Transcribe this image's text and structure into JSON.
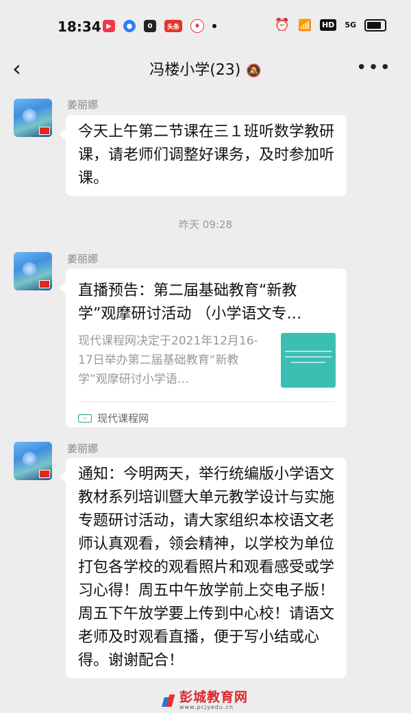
{
  "status_bar": {
    "time": "18:34",
    "apps": [
      "video-app-icon",
      "browser-app-icon",
      "dark-app-icon",
      "news-app-icon",
      "map-pin-icon"
    ],
    "news_label": "头条",
    "hd_label": "HD",
    "signal_label": "5G"
  },
  "header": {
    "title": "冯楼小学(23)",
    "mute_icon": "bell-off-icon",
    "more_icon": "more-icon"
  },
  "messages": [
    {
      "sender": "姜丽娜",
      "type": "text",
      "text": "今天上午第二节课在三１班听数学教研课，请老师们调整好课务，及时参加听课。"
    },
    {
      "type": "timestamp",
      "text": "昨天 09:28"
    },
    {
      "sender": "姜丽娜",
      "type": "link_card",
      "title": "直播预告：第二届基础教育“新教学”观摩研讨活动 （小学语文专…",
      "description": "现代课程网决定于2021年12月16-17日举办第二届基础教育“新教学”观摩研讨小学语…",
      "source": "现代课程网"
    },
    {
      "sender": "姜丽娜",
      "type": "text",
      "text": "通知：今明两天，举行统编版小学语文教材系列培训暨大单元教学设计与实施专题研讨活动，请大家组织本校语文老师认真观看，领会精神，以学校为单位打包各学校的观看照片和观看感受或学习心得！周五中午放学前上交电子版！周五下午放学要上传到中心校！请语文老师及时观看直播，便于写小结或心得。谢谢配合！"
    }
  ],
  "watermark": {
    "main": "彭城教育网",
    "url": "www.pcjyedu.cn"
  }
}
